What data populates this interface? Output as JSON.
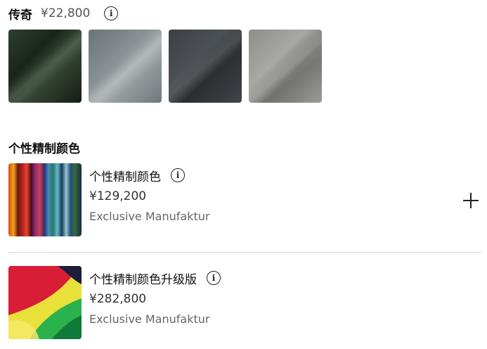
{
  "legend": {
    "title": "传奇",
    "price": "¥22,800",
    "info_icon": "info-icon"
  },
  "swatches": [
    {
      "color": "#1f2c1e"
    },
    {
      "color": "#858e91"
    },
    {
      "color": "#3f4448"
    },
    {
      "color": "#94948f"
    }
  ],
  "custom_section": {
    "title": "个性精制颜色"
  },
  "options": [
    {
      "title": "个性精制颜色",
      "price": "¥129,200",
      "subtitle": "Exclusive Manufaktur",
      "info_icon": "info-icon",
      "add_icon": "plus-icon"
    },
    {
      "title": "个性精制颜色升级版",
      "price": "¥282,800",
      "subtitle": "Exclusive Manufaktur",
      "info_icon": "info-icon"
    }
  ]
}
